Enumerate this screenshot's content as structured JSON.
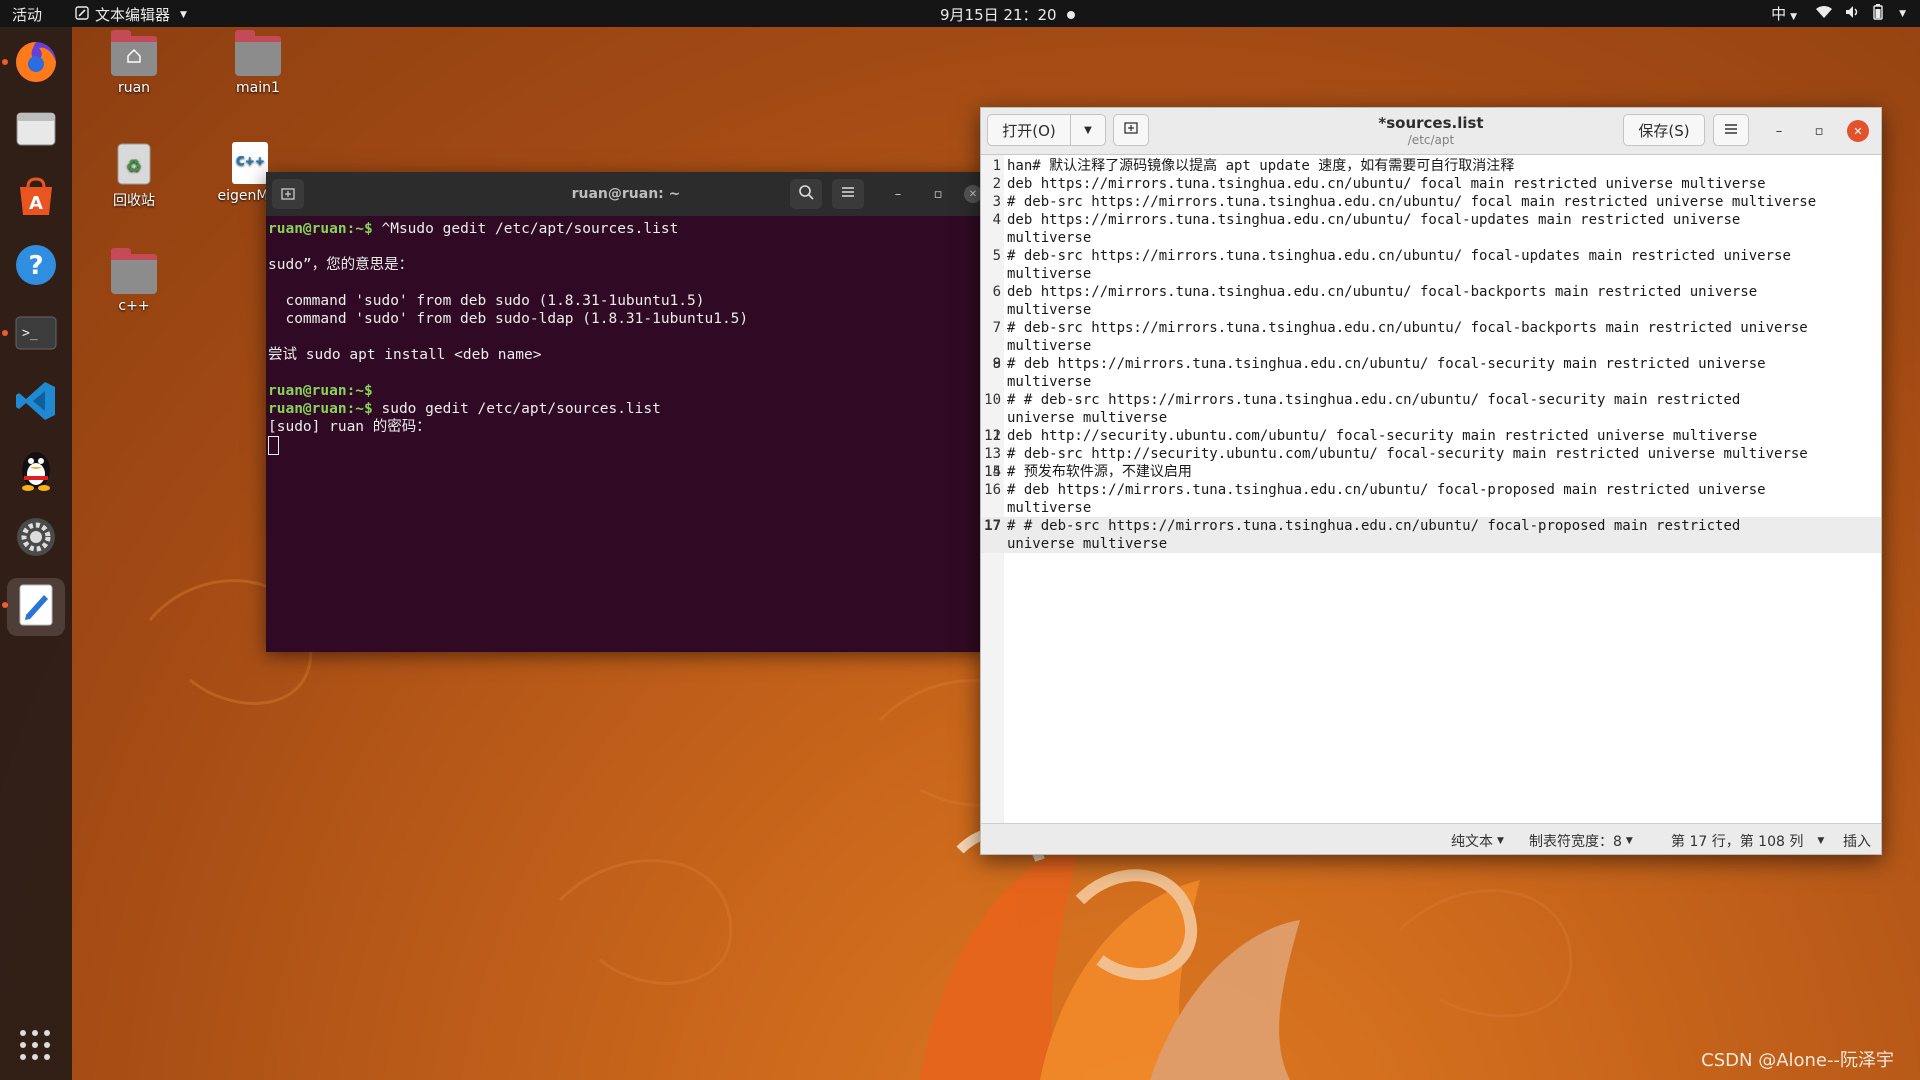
{
  "topbar": {
    "activities": "活动",
    "app_menu": "文本编辑器",
    "clock": "9月15日 21：20",
    "input_method": "中"
  },
  "desktop": {
    "icons": [
      {
        "label": "ruan"
      },
      {
        "label": "main1"
      },
      {
        "label": "回收站"
      },
      {
        "label": "eigenMat"
      },
      {
        "label": "c++"
      }
    ],
    "eigen_badge": "C++"
  },
  "terminal": {
    "title": "ruan@ruan: ~",
    "prompt": "ruan@ruan:~$",
    "cmd1": " ^Msudo gedit /etc/apt/sources.list",
    "out1": "sudo”，您的意思是：",
    "out2": "  command 'sudo' from deb sudo (1.8.31-1ubuntu1.5)",
    "out3": "  command 'sudo' from deb sudo-ldap (1.8.31-1ubuntu1.5)",
    "out4": "尝试 sudo apt install <deb name>",
    "cmd2": "",
    "cmd3": " sudo gedit /etc/apt/sources.list",
    "out5": "[sudo] ruan 的密码："
  },
  "gedit": {
    "open_label": "打开(O)",
    "save_label": "保存(S)",
    "title": "*sources.list",
    "subtitle": "/etc/apt",
    "lines": [
      {
        "n": "1",
        "text": "han# 默认注释了源码镜像以提高 apt update 速度，如有需要可自行取消注释"
      },
      {
        "n": "2",
        "text": "deb https://mirrors.tuna.tsinghua.edu.cn/ubuntu/ focal main restricted universe multiverse"
      },
      {
        "n": "3",
        "text": "# deb-src https://mirrors.tuna.tsinghua.edu.cn/ubuntu/ focal main restricted universe multiverse"
      },
      {
        "n": "4",
        "text": "deb https://mirrors.tuna.tsinghua.edu.cn/ubuntu/ focal-updates main restricted universe\nmultiverse"
      },
      {
        "n": "5",
        "text": "# deb-src https://mirrors.tuna.tsinghua.edu.cn/ubuntu/ focal-updates main restricted universe\nmultiverse"
      },
      {
        "n": "6",
        "text": "deb https://mirrors.tuna.tsinghua.edu.cn/ubuntu/ focal-backports main restricted universe\nmultiverse"
      },
      {
        "n": "7",
        "text": "# deb-src https://mirrors.tuna.tsinghua.edu.cn/ubuntu/ focal-backports main restricted universe\nmultiverse"
      },
      {
        "n": "8",
        "text": ""
      },
      {
        "n": "9",
        "text": "# deb https://mirrors.tuna.tsinghua.edu.cn/ubuntu/ focal-security main restricted universe\nmultiverse"
      },
      {
        "n": "10",
        "text": "# # deb-src https://mirrors.tuna.tsinghua.edu.cn/ubuntu/ focal-security main restricted\nuniverse multiverse"
      },
      {
        "n": "11",
        "text": ""
      },
      {
        "n": "12",
        "text": "deb http://security.ubuntu.com/ubuntu/ focal-security main restricted universe multiverse"
      },
      {
        "n": "13",
        "text": "# deb-src http://security.ubuntu.com/ubuntu/ focal-security main restricted universe multiverse"
      },
      {
        "n": "14",
        "text": ""
      },
      {
        "n": "15",
        "text": "# 预发布软件源，不建议启用"
      },
      {
        "n": "16",
        "text": "# deb https://mirrors.tuna.tsinghua.edu.cn/ubuntu/ focal-proposed main restricted universe\nmultiverse"
      },
      {
        "n": "17",
        "text": "# # deb-src https://mirrors.tuna.tsinghua.edu.cn/ubuntu/ focal-proposed main restricted\nuniverse multiverse"
      }
    ],
    "current_line": "17",
    "status": {
      "lang": "纯文本",
      "tab_width": "制表符宽度：8",
      "position": "第 17 行，第 108 列",
      "mode": "插入"
    }
  },
  "watermark": "CSDN @Alone--阮泽宇",
  "colors": {
    "terminal_bg": "#300a24",
    "prompt_green": "#87d35a",
    "accent_orange": "#e2522c"
  }
}
